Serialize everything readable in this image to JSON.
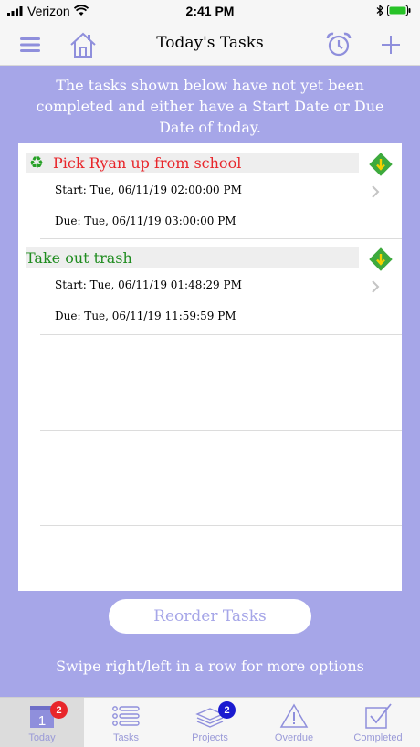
{
  "status_bar": {
    "carrier": "Verizon",
    "time": "2:41 PM"
  },
  "nav_bar": {
    "title": "Today's Tasks"
  },
  "info_text": "The tasks shown below have not yet been completed and either have a Start Date or Due Date of today.",
  "tasks": [
    {
      "title": "Pick Ryan up from school",
      "title_color": "#e8262b",
      "recurring": true,
      "start": "Start: Tue, 06/11/19 02:00:00 PM",
      "due": "Due: Tue, 06/11/19 03:00:00 PM"
    },
    {
      "title": "Take out trash",
      "title_color": "#1f8c1f",
      "recurring": false,
      "start": "Start: Tue, 06/11/19 01:48:29 PM",
      "due": "Due: Tue, 06/11/19 11:59:59 PM"
    }
  ],
  "reorder_label": "Reorder Tasks",
  "hint_text": "Swipe right/left in a row for more options",
  "tabs": [
    {
      "label": "Today",
      "icon": "calendar-icon",
      "badge": "2",
      "badge_color": "#e8262b",
      "calendar_day": "1",
      "active": true
    },
    {
      "label": "Tasks",
      "icon": "list-icon",
      "active": false
    },
    {
      "label": "Projects",
      "icon": "stack-icon",
      "badge": "2",
      "badge_color": "#1a1ad0",
      "active": false
    },
    {
      "label": "Overdue",
      "icon": "warning-icon",
      "active": false
    },
    {
      "label": "Completed",
      "icon": "checkbox-icon",
      "active": false
    }
  ],
  "colors": {
    "accent": "#a6a6e8",
    "icon": "#8f8fdc"
  }
}
